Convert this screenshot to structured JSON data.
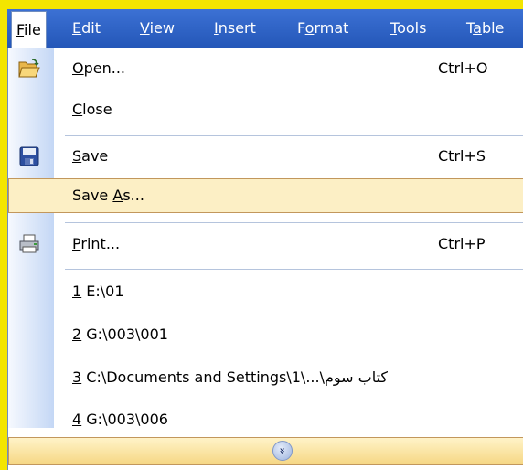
{
  "menubar": {
    "items": [
      {
        "label": "File",
        "mnemonic": "F",
        "rest": "ile"
      },
      {
        "label": "Edit",
        "mnemonic": "E",
        "rest": "dit"
      },
      {
        "label": "View",
        "mnemonic": "V",
        "rest": "iew"
      },
      {
        "label": "Insert",
        "mnemonic": "I",
        "rest": "nsert"
      },
      {
        "label": "Format",
        "pre": "F",
        "mnemonic": "o",
        "rest": "rmat"
      },
      {
        "label": "Tools",
        "mnemonic": "T",
        "rest": "ools"
      },
      {
        "label": "Table",
        "pre": "T",
        "mnemonic": "a",
        "rest": "ble"
      }
    ]
  },
  "file_menu": {
    "open": {
      "mnemonic": "O",
      "rest": "pen...",
      "shortcut": "Ctrl+O",
      "icon": "folder-open-icon"
    },
    "close": {
      "mnemonic": "C",
      "rest": "lose"
    },
    "save": {
      "mnemonic": "S",
      "rest": "ave",
      "shortcut": "Ctrl+S",
      "icon": "floppy-disk-icon"
    },
    "save_as": {
      "pre": "Save ",
      "mnemonic": "A",
      "rest": "s..."
    },
    "print": {
      "mnemonic": "P",
      "rest": "rint...",
      "shortcut": "Ctrl+P",
      "icon": "printer-icon"
    },
    "recent_files": [
      {
        "num": "1",
        "path": " E:\\01"
      },
      {
        "num": "2",
        "path": " G:\\003\\001"
      },
      {
        "num": "3",
        "path": " C:\\Documents and Settings\\1\\...\\کتاب سوم"
      },
      {
        "num": "4",
        "path": " G:\\003\\006"
      }
    ],
    "expand_glyph": "»",
    "expand_icon": "chevron-double-down-icon"
  },
  "colors": {
    "menubar": "#2f64c8",
    "highlight": "#fcefc5",
    "highlight_border": "#c2975c",
    "background": "#f3e500"
  }
}
